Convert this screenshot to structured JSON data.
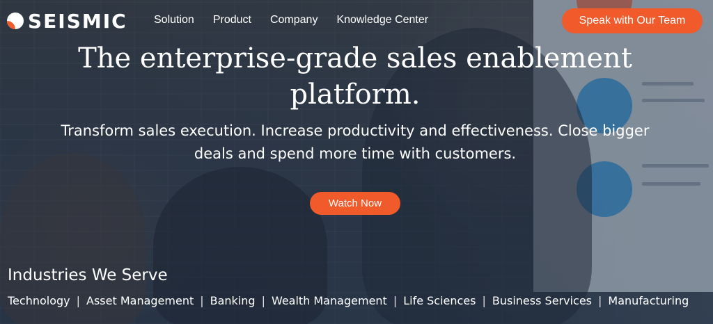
{
  "brand": {
    "name": "SEISMIC",
    "accent": "#f15a2b"
  },
  "nav": {
    "items": [
      {
        "label": "Solution"
      },
      {
        "label": "Product"
      },
      {
        "label": "Company"
      },
      {
        "label": "Knowledge Center"
      }
    ],
    "cta_label": "Speak with Our Team"
  },
  "hero": {
    "headline_line1": "The enterprise-grade sales enablement",
    "headline_line2": "platform.",
    "subhead_line1": "Transform sales execution. Increase productivity and effectiveness. Close bigger",
    "subhead_line2": "deals and spend more time with customers.",
    "cta_label": "Watch Now"
  },
  "industries": {
    "title": "Industries We Serve",
    "separator": "|",
    "items": [
      {
        "label": "Technology"
      },
      {
        "label": "Asset Management"
      },
      {
        "label": "Banking"
      },
      {
        "label": "Wealth Management"
      },
      {
        "label": "Life Sciences"
      },
      {
        "label": "Business Services"
      },
      {
        "label": "Manufacturing"
      }
    ]
  }
}
